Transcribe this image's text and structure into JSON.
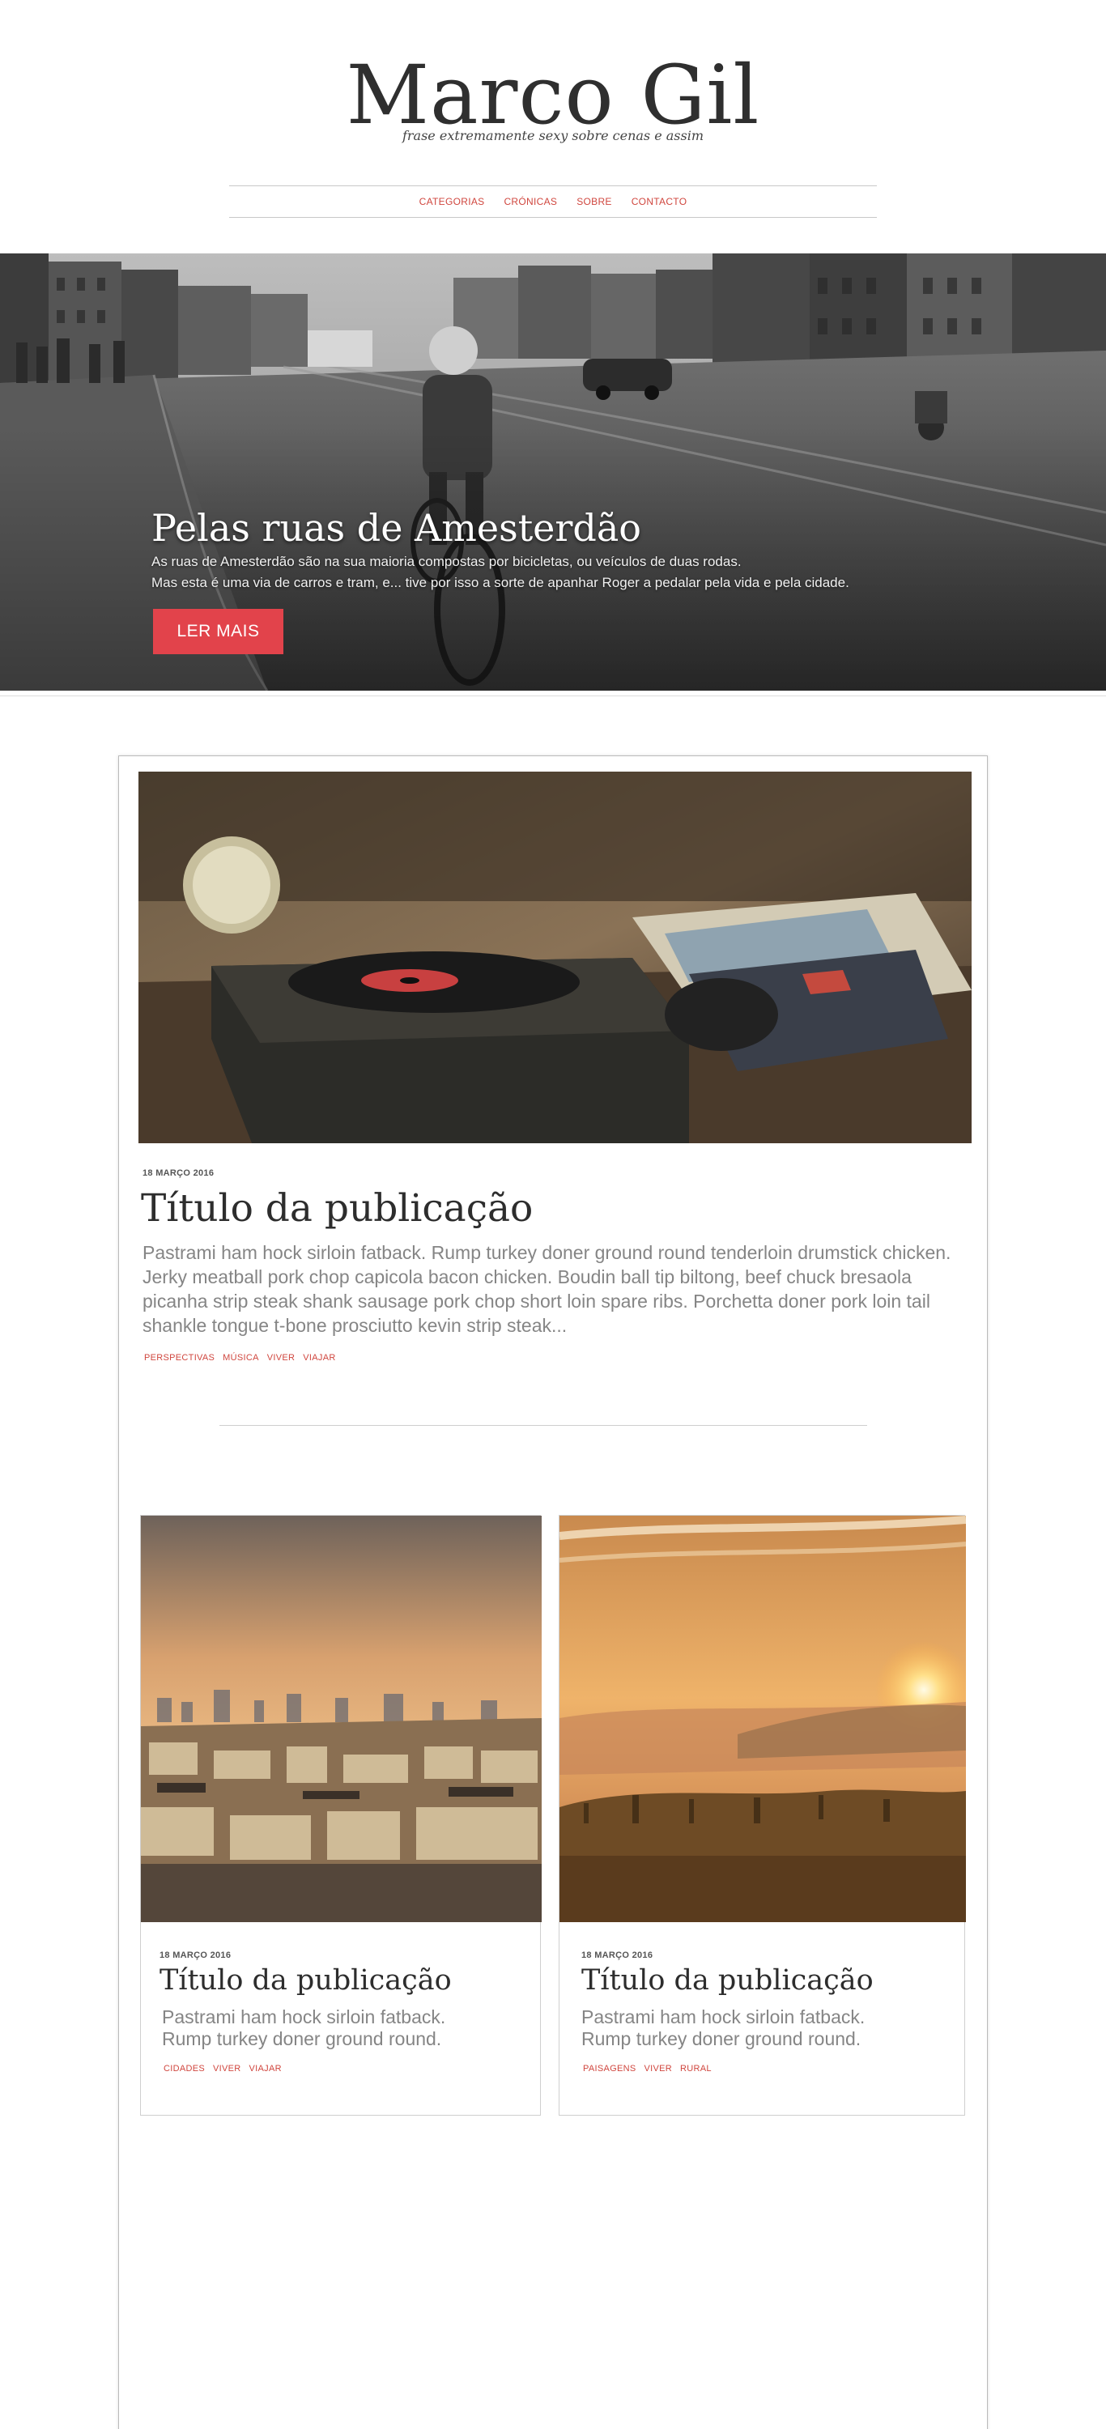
{
  "site": {
    "title": "Marco Gil",
    "tagline": "frase extremamente sexy sobre cenas e assim"
  },
  "nav": {
    "items": [
      {
        "label": "CATEGORIAS"
      },
      {
        "label": "CRÓNICAS"
      },
      {
        "label": "SOBRE"
      },
      {
        "label": "CONTACTO"
      }
    ]
  },
  "hero": {
    "title": "Pelas ruas de Amesterdão",
    "excerpt_line1": "As ruas de Amesterdão são na sua maioria compostas por bicicletas, ou veículos de duas rodas.",
    "excerpt_line2": "Mas esta é uma via de carros e tram, e... tive por isso a sorte de apanhar Roger a pedalar pela vida e pela cidade.",
    "button_label": "LER MAIS"
  },
  "featured_post": {
    "date": "18 MARÇO 2016",
    "title": "Título da publicação",
    "excerpt": "Pastrami ham hock sirloin fatback. Rump turkey doner ground round tenderloin drumstick chicken. Jerky meatball pork chop capicola bacon chicken. Boudin ball tip biltong, beef chuck bresaola picanha strip steak shank sausage pork chop short loin spare ribs. Porchetta doner pork loin tail shankle tongue t-bone prosciutto kevin strip steak...",
    "tags": [
      "PERSPECTIVAS",
      "MÚSICA",
      "VIVER",
      "VIAJAR"
    ]
  },
  "cards": [
    {
      "date": "18 MARÇO 2016",
      "title": "Título da publicação",
      "excerpt_line1": "Pastrami ham hock sirloin fatback.",
      "excerpt_line2": "Rump turkey doner ground round.",
      "tags": [
        "CIDADES",
        "VIVER",
        "VIAJAR"
      ]
    },
    {
      "date": "18 MARÇO 2016",
      "title": "Título da publicação",
      "excerpt_line1": "Pastrami ham hock sirloin fatback.",
      "excerpt_line2": "Rump turkey doner ground round.",
      "tags": [
        "PAISAGENS",
        "VIVER",
        "RURAL"
      ]
    }
  ],
  "colors": {
    "accent": "#d0463e",
    "button": "#e2434b",
    "title": "#2f2f2f"
  }
}
